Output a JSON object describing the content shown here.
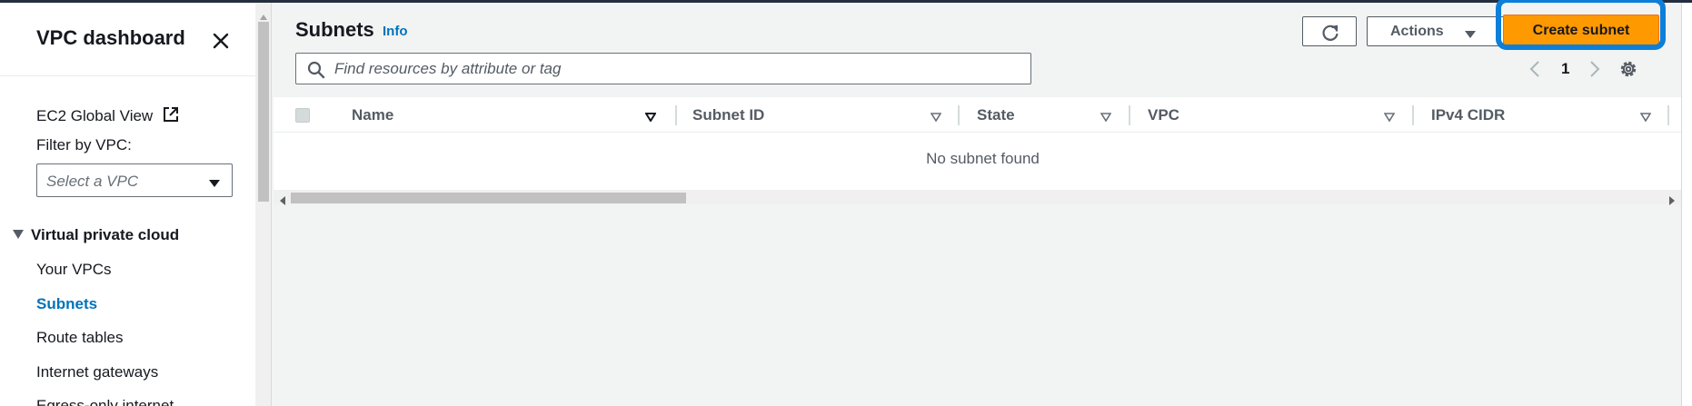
{
  "sidebar": {
    "title": "VPC dashboard",
    "ec2_global_view": "EC2 Global View",
    "filter_label": "Filter by VPC:",
    "select_placeholder": "Select a VPC",
    "section_heading": "Virtual private cloud",
    "items": [
      {
        "label": "Your VPCs"
      },
      {
        "label": "Subnets"
      },
      {
        "label": "Route tables"
      },
      {
        "label": "Internet gateways"
      },
      {
        "label": "Egress-only internet"
      }
    ]
  },
  "main": {
    "title": "Subnets",
    "info": "Info",
    "actions_label": "Actions",
    "create_label": "Create subnet",
    "search_placeholder": "Find resources by attribute or tag",
    "page": "1",
    "columns": [
      "Name",
      "Subnet ID",
      "State",
      "VPC",
      "IPv4 CIDR"
    ],
    "empty_text": "No subnet found"
  },
  "colors": {
    "primary_button": "#ff9900",
    "active_link": "#0073bb",
    "highlight_annotation": "#0b7fd9"
  }
}
